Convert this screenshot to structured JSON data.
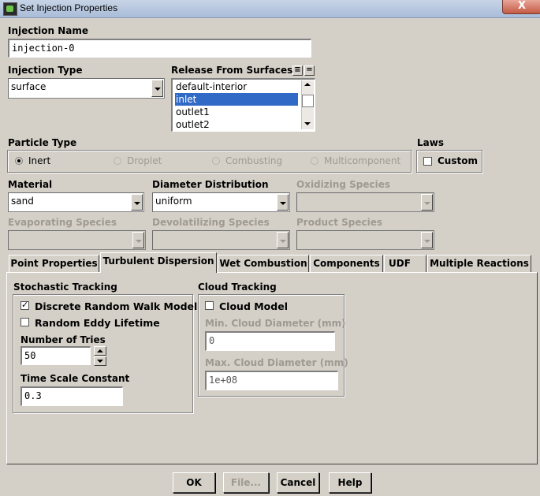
{
  "window": {
    "title": "Set Injection Properties",
    "close": "X"
  },
  "injection_name": {
    "label": "Injection Name",
    "value": "injection-0"
  },
  "injection_type": {
    "label": "Injection Type",
    "value": "surface"
  },
  "release_from_surfaces": {
    "label": "Release From Surfaces",
    "items": [
      "default-interior",
      "inlet",
      "outlet1",
      "outlet2"
    ],
    "selected": "inlet"
  },
  "particle_type": {
    "label": "Particle Type",
    "options": [
      "Inert",
      "Droplet",
      "Combusting",
      "Multicomponent"
    ],
    "selected": "Inert"
  },
  "laws": {
    "label": "Laws",
    "custom_label": "Custom",
    "custom_checked": false
  },
  "material": {
    "label": "Material",
    "value": "sand"
  },
  "diameter_distribution": {
    "label": "Diameter Distribution",
    "value": "uniform"
  },
  "oxidizing_species": {
    "label": "Oxidizing Species",
    "value": ""
  },
  "evaporating_species": {
    "label": "Evaporating Species",
    "value": ""
  },
  "devolatilizing_species": {
    "label": "Devolatilizing Species",
    "value": ""
  },
  "product_species": {
    "label": "Product Species",
    "value": ""
  },
  "tabs": [
    "Point Properties",
    "Turbulent Dispersion",
    "Wet Combustion",
    "Components",
    "UDF",
    "Multiple Reactions"
  ],
  "active_tab": "Turbulent Dispersion",
  "stochastic_tracking": {
    "label": "Stochastic Tracking",
    "drw_label": "Discrete Random Walk Model",
    "drw_checked": true,
    "rel_label": "Random Eddy Lifetime",
    "rel_checked": false,
    "tries_label": "Number of Tries",
    "tries_value": "50",
    "tsc_label": "Time Scale Constant",
    "tsc_value": "0.3"
  },
  "cloud_tracking": {
    "label": "Cloud Tracking",
    "model_label": "Cloud Model",
    "model_checked": false,
    "min_label": "Min. Cloud Diameter (mm)",
    "min_value": "0",
    "max_label": "Max. Cloud Diameter (mm)",
    "max_value": "1e+08"
  },
  "buttons": {
    "ok": "OK",
    "file": "File...",
    "cancel": "Cancel",
    "help": "Help"
  },
  "colors": {
    "selection": "#3169c6",
    "dialog_bg": "#d4d0c8",
    "disabled_text": "#9e9a92"
  }
}
